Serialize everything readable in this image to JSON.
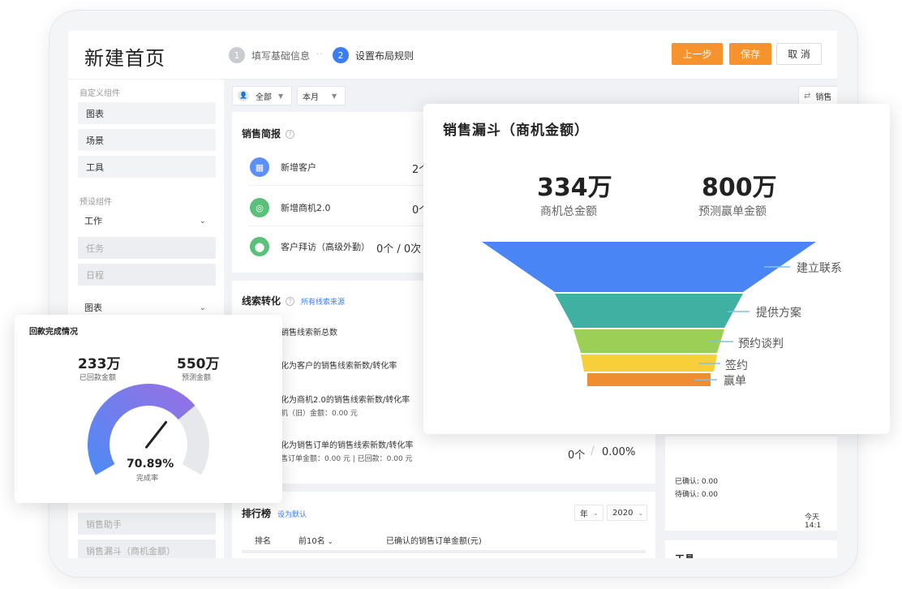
{
  "header": {
    "title": "新建首页",
    "steps": [
      {
        "num": "1",
        "label": "填写基础信息"
      },
      {
        "num": "2",
        "label": "设置布局规则"
      }
    ],
    "step_sep": "··",
    "buttons": {
      "prev": "上一步",
      "save": "保存",
      "cancel": "取 消"
    }
  },
  "sidebar": {
    "custom_group": "自定义组件",
    "custom_items": [
      "图表",
      "场景",
      "工具"
    ],
    "preset_group": "预设组件",
    "work_label": "工作",
    "work_items": [
      "任务",
      "日程"
    ],
    "chart_label": "图表",
    "chart_items": [
      "销售助手",
      "销售漏斗（商机金额）"
    ]
  },
  "filters": {
    "scope": "全部",
    "period": "本月",
    "right_label": "销售"
  },
  "sales_brief": {
    "title": "销售简报",
    "help": "?",
    "rows": [
      {
        "label": "新增客户",
        "value": "2个",
        "icon": "building-icon",
        "color": "#5b8ff9"
      },
      {
        "label": "新增商机2.0",
        "value": "0个",
        "icon": "target-icon",
        "color": "#5ac07a"
      },
      {
        "label": "客户拜访（高级外勤）",
        "value": "0个 / 0次",
        "icon": "location-pin-icon",
        "color": "#5ac07a"
      }
    ]
  },
  "lead_conversion": {
    "title": "线索转化",
    "help": "?",
    "link": "所有线索来源",
    "rows": [
      {
        "text": "销售线索新总数",
        "sub": ""
      },
      {
        "text": "化为客户的销售线索新数/转化率",
        "sub": ""
      },
      {
        "text": "化为商机2.0的销售线索新数/转化率",
        "sub": "机（旧）金额：0.00 元"
      },
      {
        "text": "化为销售订单的销售线索新数/转化率",
        "sub": "售订单金额：0.00 元  |  已回款：0.00 元"
      }
    ],
    "last_value": "0个",
    "last_rate": "0.00%"
  },
  "right_card": {
    "confirmed": "已确认: 0.00",
    "pending": "待确认: 0.00",
    "time": "今天 14:1"
  },
  "tools_card": {
    "title": "工具"
  },
  "ranking": {
    "title": "排行榜",
    "link": "设为默认",
    "year_select": "年",
    "year_value": "2020",
    "columns": [
      "排名",
      "前10名",
      "已确认的销售订单金额(元)"
    ]
  },
  "funnel": {
    "title": "销售漏斗（商机金额）",
    "total_value": "334万",
    "total_label": "商机总金额",
    "forecast_value": "800万",
    "forecast_label": "预测赢单金额",
    "stages": [
      {
        "name": "建立联系",
        "color": "#4a85f6"
      },
      {
        "name": "提供方案",
        "color": "#3fb0a2"
      },
      {
        "name": "预约谈判",
        "color": "#9ccf55"
      },
      {
        "name": "签约",
        "color": "#f6cf3a"
      },
      {
        "name": "赢单",
        "color": "#f08c32"
      }
    ],
    "line_color": "#7fc1e8"
  },
  "repayment": {
    "title": "回款完成情况",
    "received_value": "233万",
    "received_label": "已回款金额",
    "forecast_value": "550万",
    "forecast_label": "预测金额",
    "percent": "70.89%",
    "percent_label": "完成率",
    "ratio": 0.7089
  }
}
